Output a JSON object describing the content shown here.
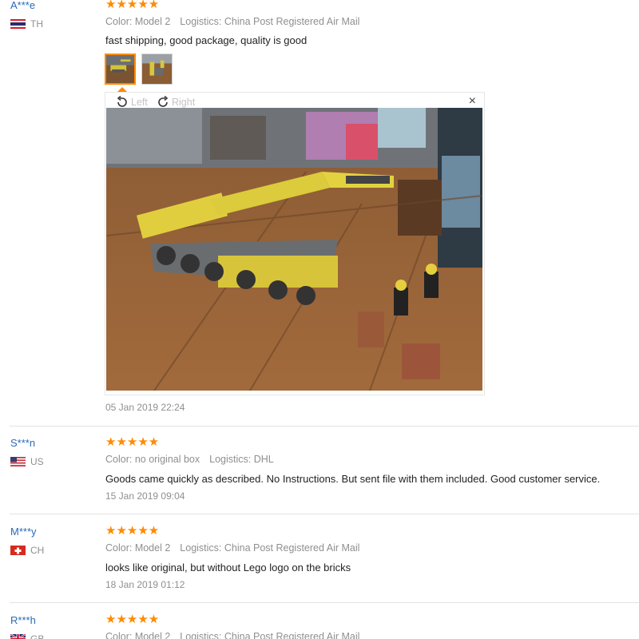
{
  "colors": {
    "accent": "#ff8a00",
    "username": "#2a6ab8",
    "muted": "#8f8f8f"
  },
  "reviews": [
    {
      "user": "A***e",
      "country": "TH",
      "flag": "thailand-flag-icon",
      "stars": "★★★★★",
      "color": "Color: Model 2",
      "logistics": "Logistics: China Post Registered Air Mail",
      "text": "fast shipping, good package, quality is good",
      "date": "05 Jan 2019 22:24"
    },
    {
      "user": "S***n",
      "country": "US",
      "flag": "usa-flag-icon",
      "stars": "★★★★★",
      "color": "Color: no original box",
      "logistics": "Logistics: DHL",
      "text": "Goods came quickly as described. No Instructions. But sent file with them included. Good customer service.",
      "date": "15 Jan 2019 09:04"
    },
    {
      "user": "M***y",
      "country": "CH",
      "flag": "switzerland-flag-icon",
      "stars": "★★★★★",
      "color": "Color: Model 2",
      "logistics": "Logistics: China Post Registered Air Mail",
      "text": "looks like original, but without Lego logo on the bricks",
      "date": "18 Jan 2019 01:12"
    },
    {
      "user": "R***h",
      "country": "GB",
      "flag": "uk-flag-icon",
      "stars": "★★★★★",
      "color": "Color: Model 2",
      "logistics": "Logistics: China Post Registered Air Mail"
    }
  ],
  "viewer": {
    "rotate_left": "Left",
    "rotate_right": "Right",
    "close": "×"
  }
}
